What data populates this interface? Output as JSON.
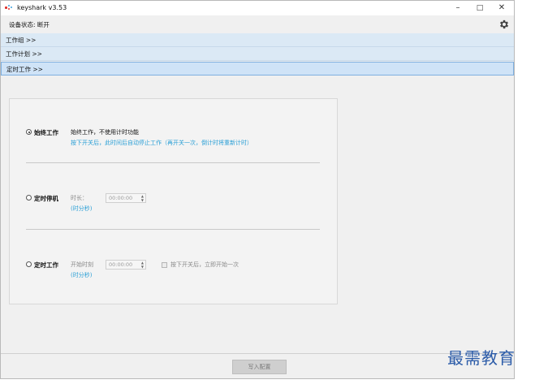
{
  "window": {
    "title": "keyshark v3.53",
    "controls": {
      "minimize": "–",
      "maximize": "□",
      "close": "✕"
    }
  },
  "status": {
    "text": "设备状态: 断开",
    "settings_icon": "gear-icon"
  },
  "sections": [
    {
      "label": "工作组  >>"
    },
    {
      "label": "工作计划  >>"
    },
    {
      "label": "定时工作  >>"
    }
  ],
  "options": {
    "always": {
      "label": "始终工作",
      "desc": "始终工作，不使用计时功能",
      "note": "按下开关后，此时间后自动停止工作（再开关一次，倒计时将重新计时）",
      "selected": true
    },
    "timed_stop": {
      "label": "定时停机",
      "field_label": "时长：",
      "unit": "(时分秒)",
      "value": "00:00:00",
      "selected": false
    },
    "timed_work": {
      "label": "定时工作",
      "field_label": "开始时刻",
      "unit": "(时分秒)",
      "value": "00:00:00",
      "checkbox_label": "按下开关后，立即开始一次",
      "selected": false
    }
  },
  "footer": {
    "write_button": "写入配置"
  },
  "watermark": "最需教育",
  "colors": {
    "accent_blue": "#2a9fd6",
    "section_bg": "#dbe9f5",
    "watermark": "#2b5ba8"
  }
}
